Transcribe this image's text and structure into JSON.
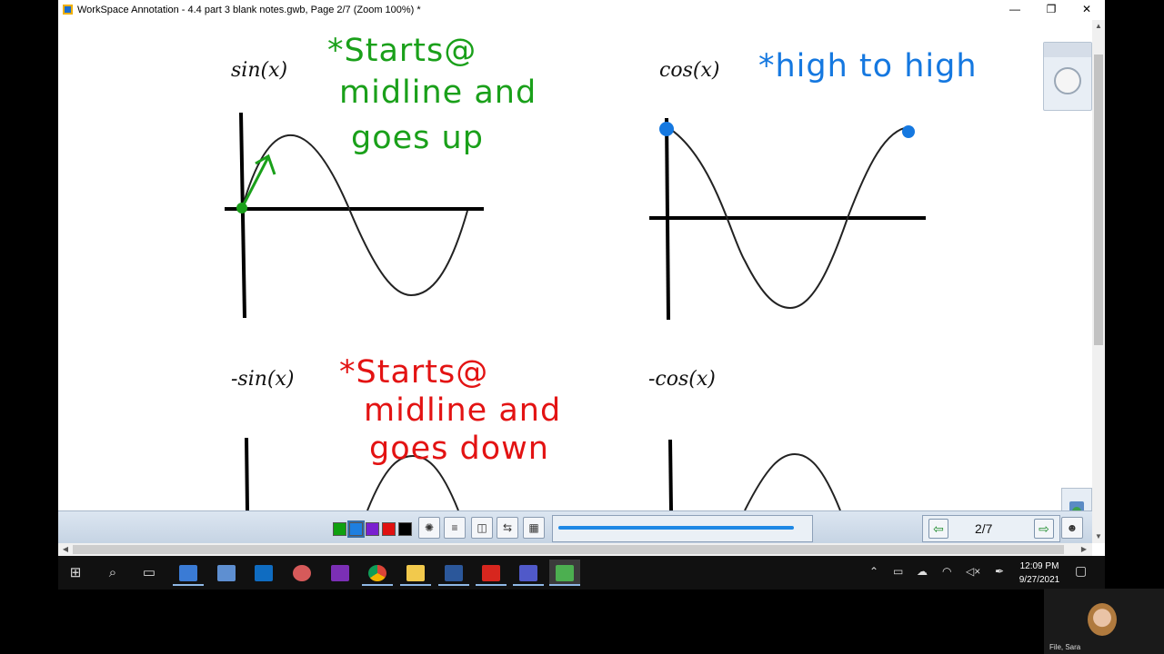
{
  "window": {
    "title": "WorkSpace Annotation - 4.4 part 3 blank notes.gwb, Page 2/7  (Zoom 100%) *",
    "minimize": "—",
    "restore": "❐",
    "close": "✕"
  },
  "document": {
    "graphs": [
      {
        "label": "sin(x)"
      },
      {
        "label": "cos(x)"
      },
      {
        "label": "-sin(x)"
      },
      {
        "label": "-cos(x)"
      }
    ],
    "annotations": {
      "green": [
        "*Starts@",
        "midline and",
        "goes up"
      ],
      "blue": "*high to high",
      "red": [
        "*Starts@",
        "midline and",
        "goes down"
      ]
    },
    "ink_colors": {
      "green": "#1aa01a",
      "blue": "#1578e0",
      "red": "#e31313"
    }
  },
  "toolbar": {
    "swatches": [
      "#10a010",
      "#1e7fe0",
      "#7a1fd0",
      "#e01010",
      "#000000"
    ],
    "pen_width_fraction": 0.95,
    "page_indicator": "2/7",
    "prev_icon": "arrow-left-icon",
    "next_icon": "arrow-right-icon"
  },
  "taskbar": {
    "time": "12:09 PM",
    "date": "9/27/2021"
  },
  "webcam": {
    "name": "File, Sara"
  }
}
